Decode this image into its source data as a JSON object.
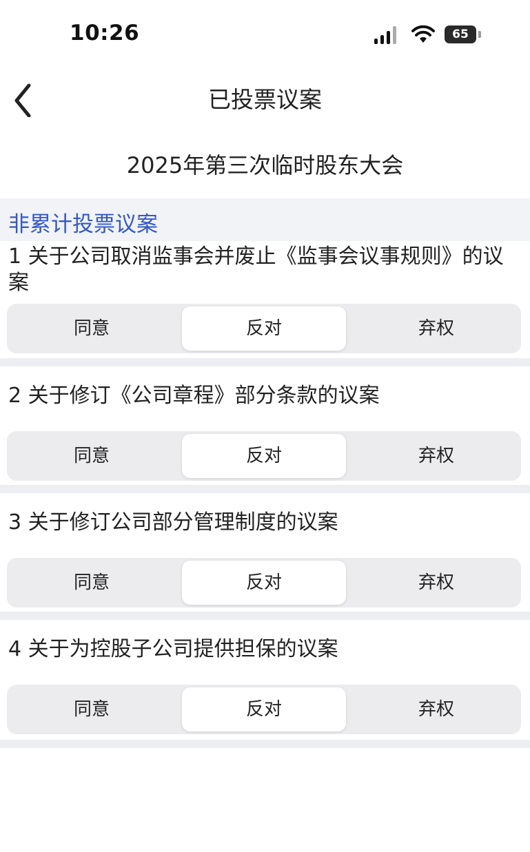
{
  "status_bar": {
    "time": "10:26",
    "battery": "65"
  },
  "nav": {
    "title": "已投票议案",
    "back_icon": "chevron-left-icon"
  },
  "meeting_title": "2025年第三次临时股东大会",
  "section": {
    "label": "非累计投票议案"
  },
  "items": [
    {
      "title": "1 关于公司取消监事会并废止《监事会议事规则》的议案",
      "options": [
        "同意",
        "反对",
        "弃权"
      ],
      "selected": "反对"
    },
    {
      "title": "2 关于修订《公司章程》部分条款的议案",
      "options": [
        "同意",
        "反对",
        "弃权"
      ],
      "selected": "反对"
    },
    {
      "title": "3 关于修订公司部分管理制度的议案",
      "options": [
        "同意",
        "反对",
        "弃权"
      ],
      "selected": "反对"
    },
    {
      "title": "4 关于为控股子公司提供担保的议案",
      "options": [
        "同意",
        "反对",
        "弃权"
      ],
      "selected": "反对"
    }
  ],
  "colors": {
    "accent": "#3458c8",
    "segment_bg": "#ececef",
    "section_bg": "#f1f3f7"
  }
}
